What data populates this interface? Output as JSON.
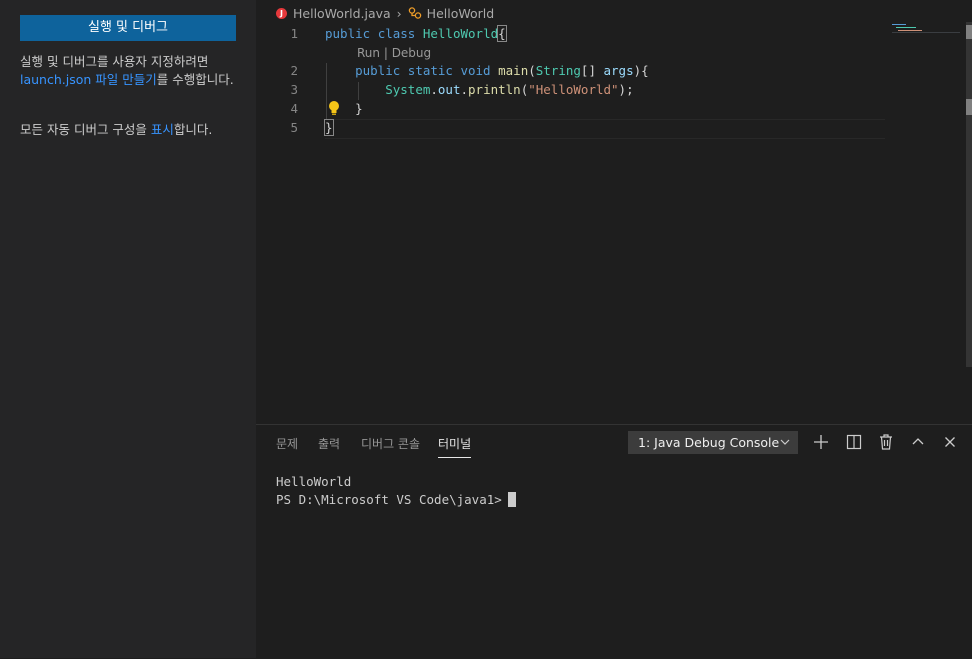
{
  "sidebar": {
    "run_debug_label": "실행 및 디버그",
    "para1_pre": "실행 및 디버그를 사용자 지정하려면 ",
    "para1_link": "launch.json 파일 만들기",
    "para1_post": "를 수행합니다.",
    "para2_pre": "모든 자동 디버그 구성을 ",
    "para2_link": "표시",
    "para2_post": "합니다."
  },
  "editor": {
    "breadcrumb": {
      "file": "HelloWorld.java",
      "symbol": "HelloWorld"
    },
    "codelens": {
      "run": "Run",
      "sep": " | ",
      "debug": "Debug"
    },
    "line_numbers": [
      "1",
      "2",
      "3",
      "4",
      "5"
    ],
    "code": {
      "l1_kw1": "public",
      "l1_kw2": "class",
      "l1_cls": "HelloWorld",
      "l1_brace": "{",
      "l2_kw1": "public",
      "l2_kw2": "static",
      "l2_kw3": "void",
      "l2_fn": "main",
      "l2_paren": "(",
      "l2_type": "String",
      "l2_arr": "[] ",
      "l2_var": "args",
      "l2_end": "){",
      "l3_cls": "System",
      "l3_dot1": ".",
      "l3_var": "out",
      "l3_dot2": ".",
      "l3_fn": "println",
      "l3_open": "(",
      "l3_str": "\"HelloWorld\"",
      "l3_end": ");",
      "l4": "}",
      "l5": "}"
    }
  },
  "panel": {
    "tabs": [
      "문제",
      "출력",
      "디버그 콘솔",
      "터미널"
    ],
    "active_tab": "터미널",
    "console_select": "1: Java Debug Console",
    "terminal_lines": [
      "HelloWorld",
      "PS D:\\Microsoft VS Code\\java1>"
    ]
  },
  "colors": {
    "accent_button": "#0e639c",
    "link": "#3794ff",
    "keyword": "#569cd6",
    "type": "#4ec9b0",
    "function": "#dcdcaa",
    "string": "#ce9178",
    "lightbulb": "#f5c518",
    "java_icon": "#e5383b"
  },
  "icons": {
    "breadcrumb_file": "java-file-icon",
    "breadcrumb_symbol": "class-symbol-icon",
    "add": "plus-icon",
    "split": "split-terminal-icon",
    "trash": "trash-icon",
    "maximize": "chevron-up-icon",
    "close": "close-icon"
  }
}
